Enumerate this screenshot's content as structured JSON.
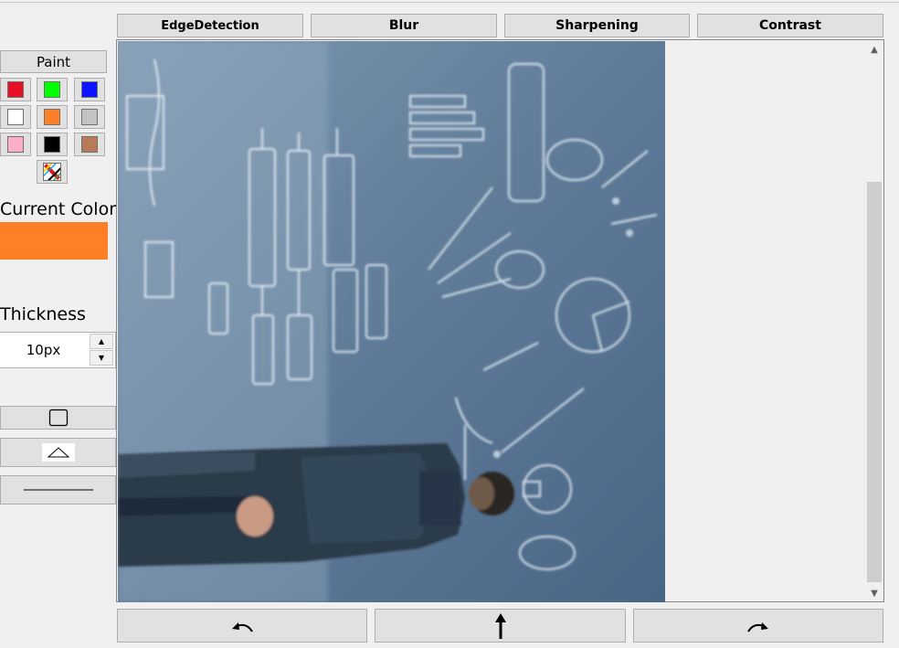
{
  "filters": {
    "edge_detection": "EdgeDetection",
    "blur": "Blur",
    "sharpening": "Sharpening",
    "contrast": "Contrast"
  },
  "paint": {
    "button_label": "Paint",
    "swatches": [
      {
        "name": "red",
        "color": "#e81123"
      },
      {
        "name": "green",
        "color": "#00ff00"
      },
      {
        "name": "blue",
        "color": "#0a14ff"
      },
      {
        "name": "white",
        "color": "#ffffff"
      },
      {
        "name": "orange",
        "color": "#ff7f27"
      },
      {
        "name": "light-gray",
        "color": "#c3c3c3"
      },
      {
        "name": "pink",
        "color": "#ffaec9"
      },
      {
        "name": "black",
        "color": "#000000"
      },
      {
        "name": "brown",
        "color": "#b97a57"
      }
    ],
    "current_color_label": "Current Color",
    "current_color": "#ff7f27"
  },
  "thickness": {
    "label": "Thickness",
    "value": "10px"
  },
  "shapes": [
    "rectangle-icon",
    "triangle-icon",
    "line-icon"
  ],
  "bottom_toolbar": [
    "rotate-left-icon",
    "up-arrow-icon",
    "rotate-right-icon"
  ],
  "scrollbar": {
    "position_fraction": 0.25
  }
}
